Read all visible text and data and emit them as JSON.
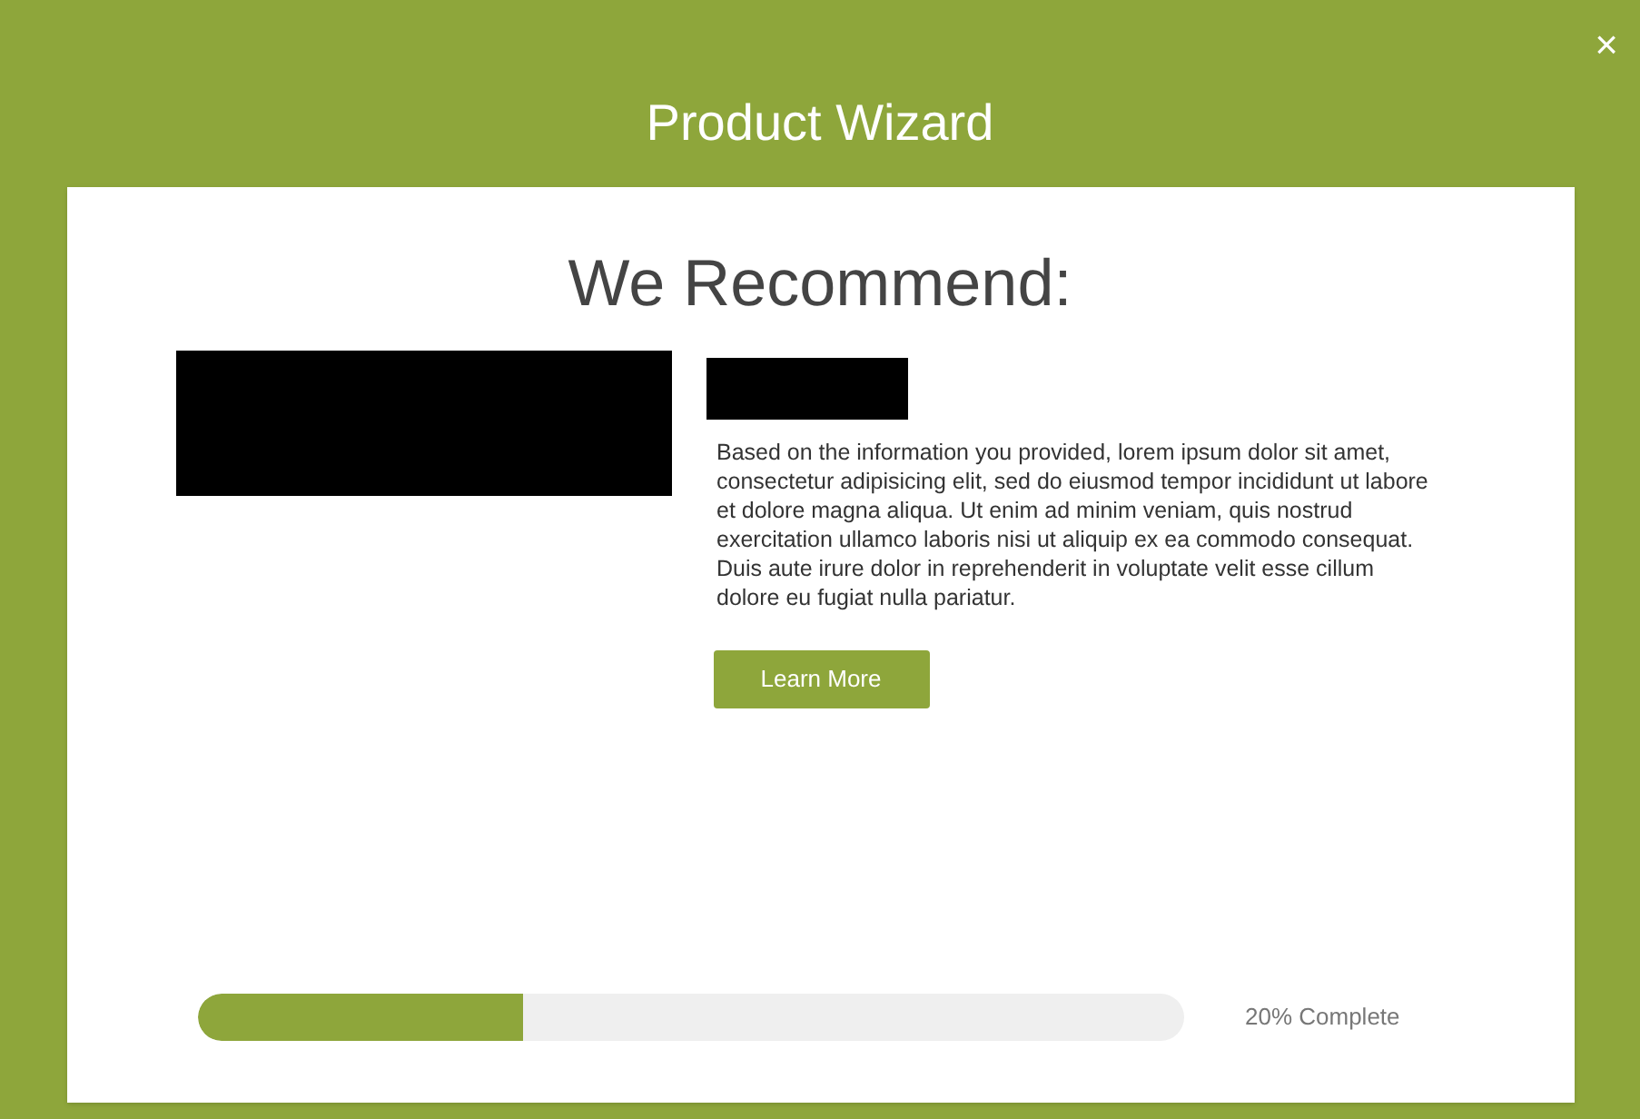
{
  "dialog": {
    "title": "Product Wizard",
    "close": "×"
  },
  "recommendation": {
    "heading": "We Recommend:",
    "description": "Based on the information you provided, lorem ipsum dolor sit amet, consectetur adipisicing elit, sed do eiusmod tempor incididunt ut labore et dolore magna aliqua. Ut enim ad minim veniam, quis nostrud exercitation ullamco laboris nisi ut aliquip ex ea commodo consequat. Duis aute irure dolor in reprehenderit in voluptate velit esse cillum dolore eu fugiat nulla pariatur.",
    "button": "Learn More"
  },
  "progress": {
    "level": 0.33,
    "reading": "20% Complete"
  }
}
